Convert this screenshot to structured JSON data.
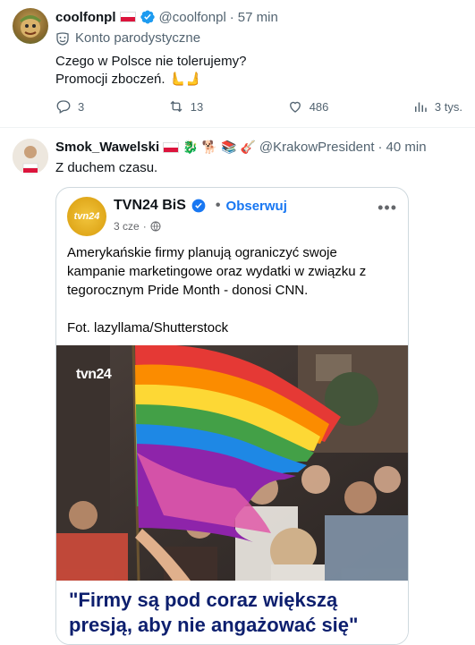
{
  "post1": {
    "display_name": "coolfonpl",
    "handle": "@coolfonpl",
    "time": "57 min",
    "parody_label": "Konto parodystyczne",
    "text_line1": "Czego w Polsce nie tolerujemy?",
    "text_line2": "Promocji zboczeń. 🫷🫸",
    "actions": {
      "replies": "3",
      "reposts": "13",
      "likes": "486",
      "views": "3 tys."
    }
  },
  "post2": {
    "display_name": "Smok_Wawelski",
    "handle": "@KrakowPresident",
    "time": "40 min",
    "emojis": [
      "🐉",
      "🐕",
      "📚",
      "🎸"
    ],
    "text": "Z duchem czasu.",
    "embed": {
      "page_name": "TVN24 BiS",
      "follow_label": "Obserwuj",
      "age": "3 cze",
      "logo_text": "tvn24",
      "body_paragraph1": "Amerykańskie firmy planują ograniczyć swoje kampanie marketingowe oraz wydatki w związku z tegorocznym Pride Month - donosi CNN.",
      "body_paragraph2": "Fot. lazyllama/Shutterstock",
      "photo_watermark": "tvn24",
      "headline": "\"Firmy są pod coraz większą presją, aby nie angażować się\""
    }
  },
  "colors": {
    "verified_blue": "#1d9bf0",
    "facebook_blue": "#1877f2",
    "headline_navy": "#0d1f6e",
    "secondary_text": "#536471"
  },
  "icons": [
    "mask-icon",
    "reply-icon",
    "repost-icon",
    "like-icon",
    "views-icon",
    "verified-icon",
    "globe-icon",
    "more-icon",
    "poland-flag-icon"
  ]
}
